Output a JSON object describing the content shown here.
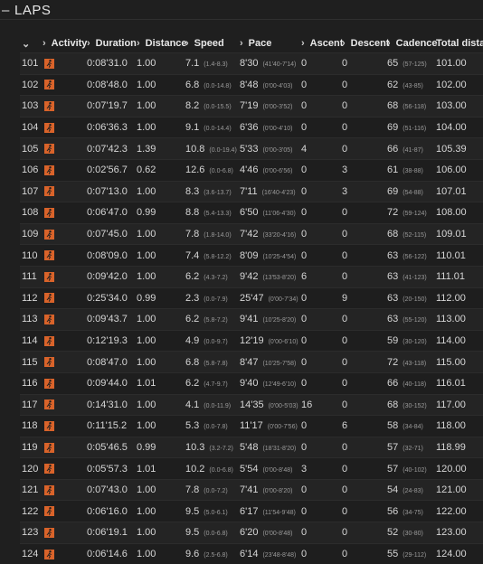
{
  "section": {
    "title": "LAPS",
    "collapse_label": "–"
  },
  "columns": [
    {
      "label": "",
      "chevron": "⌄"
    },
    {
      "label": "Activity",
      "chevron": "›"
    },
    {
      "label": "Duration",
      "chevron": "›"
    },
    {
      "label": "Distance",
      "chevron": "›"
    },
    {
      "label": "Speed",
      "chevron": "›"
    },
    {
      "label": "Pace",
      "chevron": "›"
    },
    {
      "label": "Ascent",
      "chevron": "›"
    },
    {
      "label": "Descent",
      "chevron": "›"
    },
    {
      "label": "Cadence",
      "chevron": "›"
    },
    {
      "label": "Total distance",
      "chevron": ""
    }
  ],
  "accent_color": "#d9632a",
  "rows": [
    {
      "lap": "101",
      "icon": "running-icon",
      "duration": "0:08'31.0",
      "distance": "1.00",
      "speed": "7.1",
      "speed_range": "(1.4-8.3)",
      "pace": "8'30",
      "pace_range": "(41'40-7'14)",
      "ascent": "0",
      "descent": "0",
      "cadence": "65",
      "cadence_range": "(57-125)",
      "total": "101.00"
    },
    {
      "lap": "102",
      "icon": "running-icon",
      "duration": "0:08'48.0",
      "distance": "1.00",
      "speed": "6.8",
      "speed_range": "(0.0-14.8)",
      "pace": "8'48",
      "pace_range": "(0'00-4'03)",
      "ascent": "0",
      "descent": "0",
      "cadence": "62",
      "cadence_range": "(43-85)",
      "total": "102.00"
    },
    {
      "lap": "103",
      "icon": "running-icon",
      "duration": "0:07'19.7",
      "distance": "1.00",
      "speed": "8.2",
      "speed_range": "(0.0-15.5)",
      "pace": "7'19",
      "pace_range": "(0'00-3'52)",
      "ascent": "0",
      "descent": "0",
      "cadence": "68",
      "cadence_range": "(56-118)",
      "total": "103.00"
    },
    {
      "lap": "104",
      "icon": "running-icon",
      "duration": "0:06'36.3",
      "distance": "1.00",
      "speed": "9.1",
      "speed_range": "(0.0-14.4)",
      "pace": "6'36",
      "pace_range": "(0'00-4'10)",
      "ascent": "0",
      "descent": "0",
      "cadence": "69",
      "cadence_range": "(51-116)",
      "total": "104.00"
    },
    {
      "lap": "105",
      "icon": "running-icon",
      "duration": "0:07'42.3",
      "distance": "1.39",
      "speed": "10.8",
      "speed_range": "(0.0-19.4)",
      "pace": "5'33",
      "pace_range": "(0'00-3'05)",
      "ascent": "4",
      "descent": "0",
      "cadence": "66",
      "cadence_range": "(41-87)",
      "total": "105.39"
    },
    {
      "lap": "106",
      "icon": "running-icon",
      "duration": "0:02'56.7",
      "distance": "0.62",
      "speed": "12.6",
      "speed_range": "(0.0-6.8)",
      "pace": "4'46",
      "pace_range": "(0'00-6'56)",
      "ascent": "0",
      "descent": "3",
      "cadence": "61",
      "cadence_range": "(38-88)",
      "total": "106.00"
    },
    {
      "lap": "107",
      "icon": "running-icon",
      "duration": "0:07'13.0",
      "distance": "1.00",
      "speed": "8.3",
      "speed_range": "(3.6-13.7)",
      "pace": "7'11",
      "pace_range": "(16'40-4'23)",
      "ascent": "0",
      "descent": "3",
      "cadence": "69",
      "cadence_range": "(54-88)",
      "total": "107.01"
    },
    {
      "lap": "108",
      "icon": "running-icon",
      "duration": "0:06'47.0",
      "distance": "0.99",
      "speed": "8.8",
      "speed_range": "(5.4-13.3)",
      "pace": "6'50",
      "pace_range": "(11'06-4'30)",
      "ascent": "0",
      "descent": "0",
      "cadence": "72",
      "cadence_range": "(59-124)",
      "total": "108.00"
    },
    {
      "lap": "109",
      "icon": "running-icon",
      "duration": "0:07'45.0",
      "distance": "1.00",
      "speed": "7.8",
      "speed_range": "(1.8-14.0)",
      "pace": "7'42",
      "pace_range": "(33'20-4'16)",
      "ascent": "0",
      "descent": "0",
      "cadence": "68",
      "cadence_range": "(52-115)",
      "total": "109.01"
    },
    {
      "lap": "110",
      "icon": "running-icon",
      "duration": "0:08'09.0",
      "distance": "1.00",
      "speed": "7.4",
      "speed_range": "(5.8-12.2)",
      "pace": "8'09",
      "pace_range": "(10'25-4'54)",
      "ascent": "0",
      "descent": "0",
      "cadence": "63",
      "cadence_range": "(56-122)",
      "total": "110.01"
    },
    {
      "lap": "111",
      "icon": "running-icon",
      "duration": "0:09'42.0",
      "distance": "1.00",
      "speed": "6.2",
      "speed_range": "(4.3-7.2)",
      "pace": "9'42",
      "pace_range": "(13'53-8'20)",
      "ascent": "6",
      "descent": "0",
      "cadence": "63",
      "cadence_range": "(41-123)",
      "total": "111.01"
    },
    {
      "lap": "112",
      "icon": "running-icon",
      "duration": "0:25'34.0",
      "distance": "0.99",
      "speed": "2.3",
      "speed_range": "(0.0-7.9)",
      "pace": "25'47",
      "pace_range": "(0'00-7'34)",
      "ascent": "0",
      "descent": "9",
      "cadence": "63",
      "cadence_range": "(20-150)",
      "total": "112.00"
    },
    {
      "lap": "113",
      "icon": "running-icon",
      "duration": "0:09'43.7",
      "distance": "1.00",
      "speed": "6.2",
      "speed_range": "(5.8-7.2)",
      "pace": "9'41",
      "pace_range": "(10'25-8'20)",
      "ascent": "0",
      "descent": "0",
      "cadence": "63",
      "cadence_range": "(55-120)",
      "total": "113.00"
    },
    {
      "lap": "114",
      "icon": "running-icon",
      "duration": "0:12'19.3",
      "distance": "1.00",
      "speed": "4.9",
      "speed_range": "(0.0-9.7)",
      "pace": "12'19",
      "pace_range": "(0'00-6'10)",
      "ascent": "0",
      "descent": "0",
      "cadence": "59",
      "cadence_range": "(30-120)",
      "total": "114.00"
    },
    {
      "lap": "115",
      "icon": "running-icon",
      "duration": "0:08'47.0",
      "distance": "1.00",
      "speed": "6.8",
      "speed_range": "(5.8-7.8)",
      "pace": "8'47",
      "pace_range": "(10'25-7'58)",
      "ascent": "0",
      "descent": "0",
      "cadence": "72",
      "cadence_range": "(43-118)",
      "total": "115.00"
    },
    {
      "lap": "116",
      "icon": "running-icon",
      "duration": "0:09'44.0",
      "distance": "1.01",
      "speed": "6.2",
      "speed_range": "(4.7-9.7)",
      "pace": "9'40",
      "pace_range": "(12'49-6'10)",
      "ascent": "0",
      "descent": "0",
      "cadence": "66",
      "cadence_range": "(40-118)",
      "total": "116.01"
    },
    {
      "lap": "117",
      "icon": "running-icon",
      "duration": "0:14'31.0",
      "distance": "1.00",
      "speed": "4.1",
      "speed_range": "(0.0-11.9)",
      "pace": "14'35",
      "pace_range": "(0'00-5'03)",
      "ascent": "16",
      "descent": "0",
      "cadence": "68",
      "cadence_range": "(30-152)",
      "total": "117.00"
    },
    {
      "lap": "118",
      "icon": "running-icon",
      "duration": "0:11'15.2",
      "distance": "1.00",
      "speed": "5.3",
      "speed_range": "(0.0-7.8)",
      "pace": "11'17",
      "pace_range": "(0'00-7'56)",
      "ascent": "0",
      "descent": "6",
      "cadence": "58",
      "cadence_range": "(34-84)",
      "total": "118.00"
    },
    {
      "lap": "119",
      "icon": "running-icon",
      "duration": "0:05'46.5",
      "distance": "0.99",
      "speed": "10.3",
      "speed_range": "(3.2-7.2)",
      "pace": "5'48",
      "pace_range": "(18'31-8'20)",
      "ascent": "0",
      "descent": "0",
      "cadence": "57",
      "cadence_range": "(32-71)",
      "total": "118.99"
    },
    {
      "lap": "120",
      "icon": "running-icon",
      "duration": "0:05'57.3",
      "distance": "1.01",
      "speed": "10.2",
      "speed_range": "(0.0-6.8)",
      "pace": "5'54",
      "pace_range": "(0'00-8'48)",
      "ascent": "3",
      "descent": "0",
      "cadence": "57",
      "cadence_range": "(40-102)",
      "total": "120.00"
    },
    {
      "lap": "121",
      "icon": "running-icon",
      "duration": "0:07'43.0",
      "distance": "1.00",
      "speed": "7.8",
      "speed_range": "(0.0-7.2)",
      "pace": "7'41",
      "pace_range": "(0'00-8'20)",
      "ascent": "0",
      "descent": "0",
      "cadence": "54",
      "cadence_range": "(24-83)",
      "total": "121.00"
    },
    {
      "lap": "122",
      "icon": "running-icon",
      "duration": "0:06'16.0",
      "distance": "1.00",
      "speed": "9.5",
      "speed_range": "(5.0-6.1)",
      "pace": "6'17",
      "pace_range": "(11'54-9'48)",
      "ascent": "0",
      "descent": "0",
      "cadence": "56",
      "cadence_range": "(34-75)",
      "total": "122.00"
    },
    {
      "lap": "123",
      "icon": "running-icon",
      "duration": "0:06'19.1",
      "distance": "1.00",
      "speed": "9.5",
      "speed_range": "(0.0-6.8)",
      "pace": "6'20",
      "pace_range": "(0'00-8'48)",
      "ascent": "0",
      "descent": "0",
      "cadence": "52",
      "cadence_range": "(30-80)",
      "total": "123.00"
    },
    {
      "lap": "124",
      "icon": "running-icon",
      "duration": "0:06'14.6",
      "distance": "1.00",
      "speed": "9.6",
      "speed_range": "(2.5-6.8)",
      "pace": "6'14",
      "pace_range": "(23'48-8'48)",
      "ascent": "0",
      "descent": "0",
      "cadence": "55",
      "cadence_range": "(29-112)",
      "total": "124.00"
    }
  ]
}
